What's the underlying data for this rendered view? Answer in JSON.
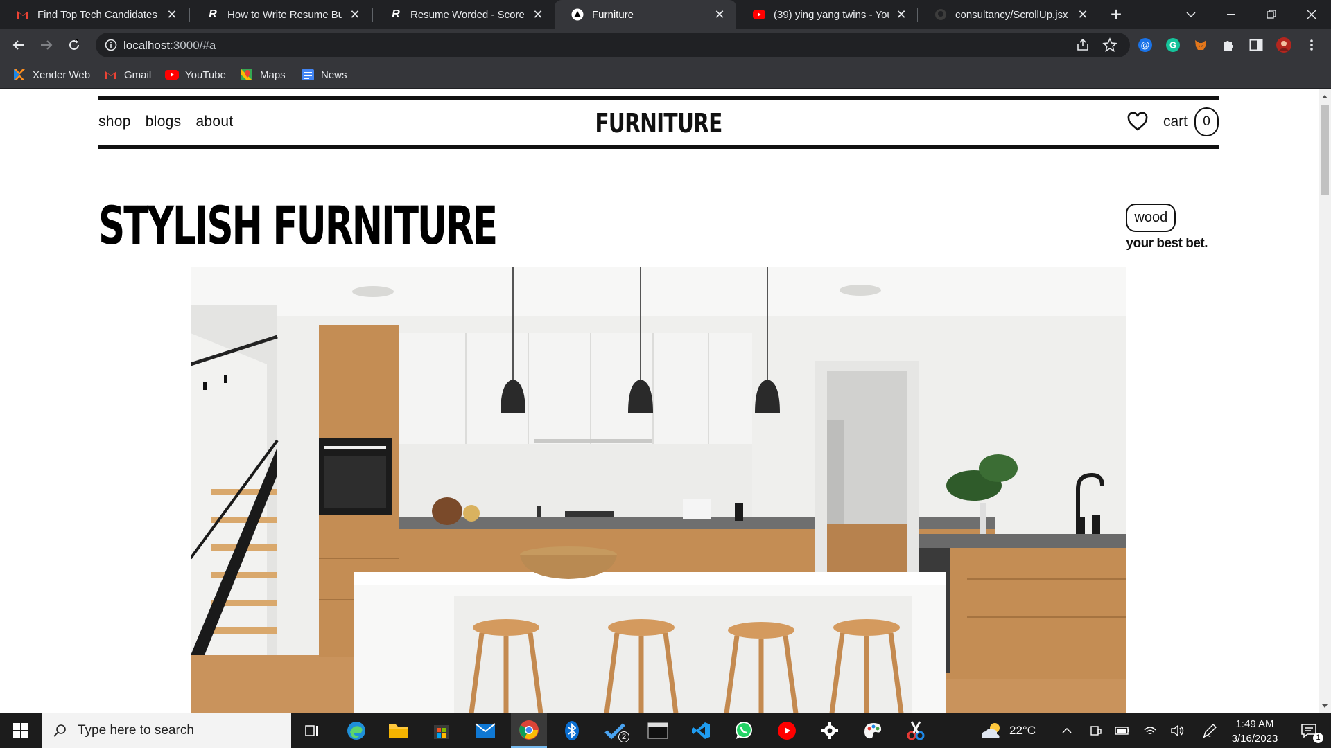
{
  "browser": {
    "tabs": [
      {
        "title": "Find Top Tech Candidates -",
        "icon": "gmail-icon"
      },
      {
        "title": "How to Write Resume Bulle",
        "icon": "resume-worded-icon"
      },
      {
        "title": "Resume Worded - Score My",
        "icon": "resume-worded-icon"
      },
      {
        "title": "Furniture",
        "icon": "site-triangle-icon"
      },
      {
        "title": "(39) ying yang twins - YouT",
        "icon": "youtube-icon"
      },
      {
        "title": "consultancy/ScrollUp.jsx at",
        "icon": "github-icon"
      }
    ],
    "active_tab_index": 3,
    "url": {
      "host": "localhost",
      "rest": ":3000/#a"
    },
    "bookmarks": [
      {
        "label": "Xender Web",
        "icon": "xender-icon"
      },
      {
        "label": "Gmail",
        "icon": "gmail-icon"
      },
      {
        "label": "YouTube",
        "icon": "youtube-icon"
      },
      {
        "label": "Maps",
        "icon": "maps-icon"
      },
      {
        "label": "News",
        "icon": "news-icon"
      }
    ]
  },
  "site": {
    "nav": [
      "shop",
      "blogs",
      "about"
    ],
    "brand": "FURNITURE",
    "cart_label": "cart",
    "cart_count": "0",
    "hero_title": "STYLISH FURNITURE",
    "tag": "wood",
    "tag_caption": "your best bet."
  },
  "taskbar": {
    "search_placeholder": "Type here to search",
    "weather": "22°C",
    "time": "1:49 AM",
    "date": "3/16/2023",
    "todo_badge": "2",
    "notification_count": "1"
  },
  "colors": {
    "chrome_dark": "#202124",
    "chrome_toolbar": "#35363a",
    "page_ink": "#111111",
    "taskbar": "#1c1c1c"
  }
}
